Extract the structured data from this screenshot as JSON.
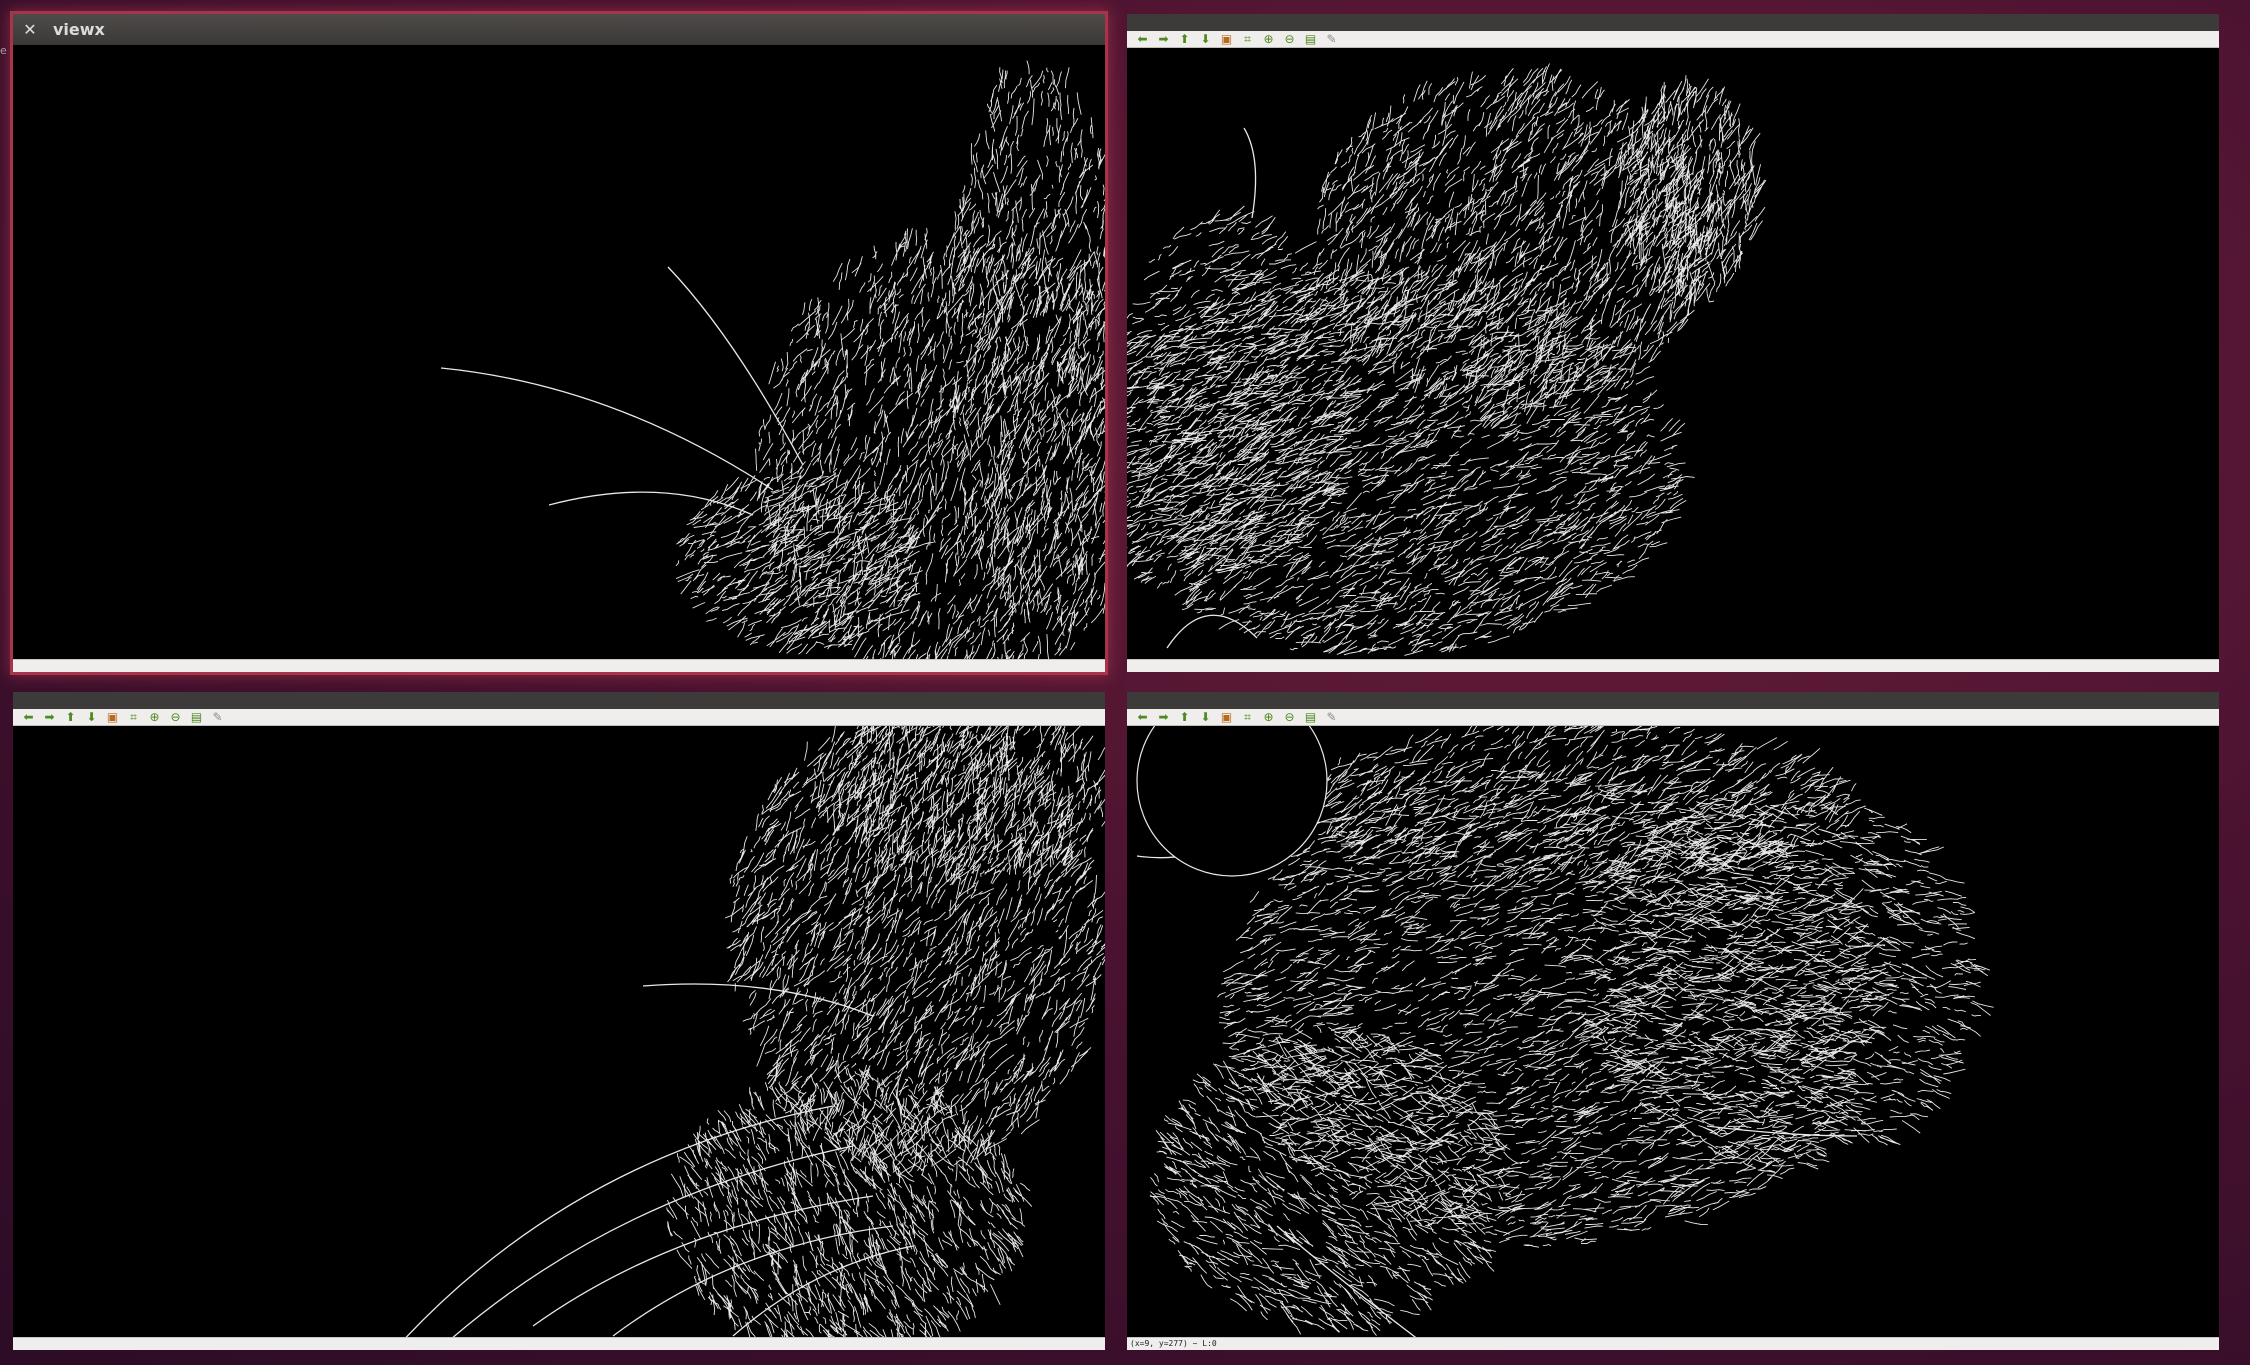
{
  "windows": {
    "top_left": {
      "title": "viewx",
      "close_glyph": "✕"
    },
    "bottom_right": {
      "status_text": "(x=9, y=277) ~ L:0"
    }
  },
  "peek_text": "e",
  "toolbar": {
    "tools": [
      {
        "name": "back-arrow-icon",
        "glyph": "⬅"
      },
      {
        "name": "forward-arrow-icon",
        "glyph": "➡"
      },
      {
        "name": "up-arrow-icon",
        "glyph": "⬆"
      },
      {
        "name": "down-arrow-icon",
        "glyph": "⬇"
      },
      {
        "name": "image-icon",
        "glyph": "▣"
      },
      {
        "name": "zoom-region-icon",
        "glyph": "⌗"
      },
      {
        "name": "zoom-in-icon",
        "glyph": "⊕"
      },
      {
        "name": "zoom-out-icon",
        "glyph": "⊖"
      },
      {
        "name": "save-icon",
        "glyph": "▤"
      },
      {
        "name": "settings-icon",
        "glyph": "✎"
      }
    ]
  },
  "colors": {
    "tool_green": "#4e8a1e",
    "tool_orange": "#b86a1c",
    "tool_gray": "#8a8a8a",
    "edge": "#e8e8e8",
    "active_border": "#a8344c"
  }
}
